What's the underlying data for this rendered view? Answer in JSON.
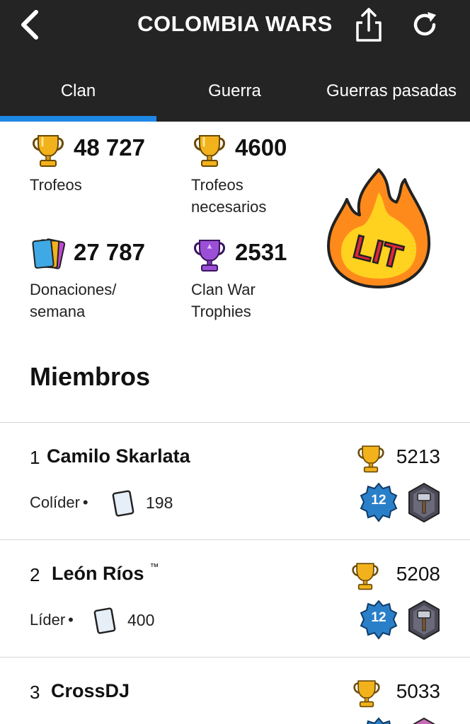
{
  "header": {
    "title": "COLOMBIA WARS",
    "tabs": [
      "Clan",
      "Guerra",
      "Guerras pasadas"
    ],
    "active_tab": "Clan",
    "icons": [
      "chevron-left-icon",
      "share-icon",
      "refresh-icon"
    ]
  },
  "stats": {
    "trophies": {
      "value": "48 727",
      "label": "Trofeos",
      "icon": "trophy-icon"
    },
    "required_trophies": {
      "value": "4600",
      "label": "Trofeos necesarios",
      "icon": "trophy-icon"
    },
    "donations": {
      "value": "27 787",
      "label": "Donaciones/ semana",
      "icon": "cards-icon"
    },
    "war_trophies": {
      "value": "2531",
      "label": "Clan War Trophies",
      "icon": "war-trophy-icon"
    }
  },
  "badge": {
    "text": "LIT"
  },
  "members_title": "Miembros",
  "members": [
    {
      "rank": "1",
      "name": "Camilo Skarlata",
      "tm": "",
      "trophies": "5213",
      "role": "Colíder",
      "donations": "198",
      "level": "12"
    },
    {
      "rank": "2",
      "name": "León Ríos",
      "tm": "™",
      "trophies": "5208",
      "role": "Líder",
      "donations": "400",
      "level": "12"
    },
    {
      "rank": "3",
      "name": "CrossDJ",
      "tm": "",
      "trophies": "5033",
      "role": "",
      "donations": "",
      "level": ""
    }
  ],
  "colors": {
    "header_bg": "#242424",
    "tab_indicator": "#1e88e5",
    "trophy_gold": "#f2b21c",
    "war_trophy_purple": "#9b4fd6",
    "level_badge": "#2a7fc9"
  }
}
